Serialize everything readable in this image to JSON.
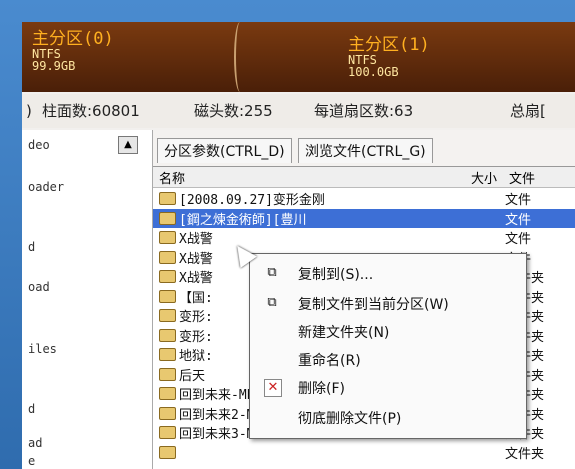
{
  "partitions": [
    {
      "name": "主分区(0)",
      "fs": "NTFS",
      "size": "99.9GB"
    },
    {
      "name": "主分区(1)",
      "fs": "NTFS",
      "size": "100.0GB"
    }
  ],
  "diskinfo": {
    "prefix": ")",
    "cylinders": "柱面数:60801",
    "heads": "磁头数:255",
    "sectors": "每道扇区数:63",
    "total": "总扇["
  },
  "tree": {
    "scroll_glyph": "▲",
    "items": [
      "deo",
      "oader",
      "d",
      "oad",
      "iles",
      "d",
      "ad",
      "e"
    ]
  },
  "tabs": [
    "分区参数(CTRL_D)",
    "浏览文件(CTRL_G)"
  ],
  "list": {
    "headers": {
      "name": "名称",
      "size": "大小",
      "type": "文件"
    },
    "rows": [
      {
        "name": "[2008.09.27]变形金刚",
        "type": "文件"
      },
      {
        "name": "[鋼之煉金術師][豊川",
        "type": "文件",
        "selected": true
      },
      {
        "name": "X战警",
        "type": "文件"
      },
      {
        "name": "X战警",
        "type": "文件"
      },
      {
        "name": "X战警",
        "type": "文件夹"
      },
      {
        "name": "【国:",
        "type": "文件夹"
      },
      {
        "name": "变形:",
        "type": "文件夹"
      },
      {
        "name": "变形:",
        "type": "文件夹"
      },
      {
        "name": "地狱:",
        "type": "文件夹"
      },
      {
        "name": "后天",
        "type": "文件夹"
      },
      {
        "name": "回到未来-MP4",
        "type": "文件夹"
      },
      {
        "name": "回到未来2-MP4",
        "type": "文件夹"
      },
      {
        "name": "回到未来3-MP4",
        "type": "文件夹"
      },
      {
        "name": "",
        "type": "文件夹"
      }
    ]
  },
  "menu": {
    "items": [
      {
        "icon": "⧉",
        "label": "复制到(S)..."
      },
      {
        "icon": "⧉",
        "label": "复制文件到当前分区(W)"
      },
      {
        "icon": "",
        "label": "新建文件夹(N)"
      },
      {
        "icon": "",
        "label": "重命名(R)"
      },
      {
        "icon": "✕",
        "label": "删除(F)"
      },
      {
        "icon": "",
        "label": "彻底删除文件(P)"
      }
    ]
  }
}
